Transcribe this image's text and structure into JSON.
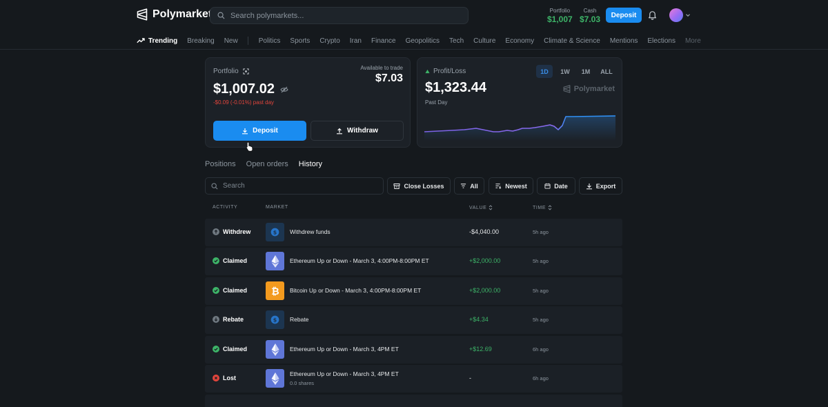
{
  "header": {
    "brand": "Polymarket",
    "search_placeholder": "Search polymarkets...",
    "portfolio_label": "Portfolio",
    "portfolio_value": "$1,007",
    "cash_label": "Cash",
    "cash_value": "$7.03",
    "deposit_label": "Deposit"
  },
  "nav": {
    "trending": "Trending",
    "items": [
      "Breaking",
      "New"
    ],
    "categories": [
      "Politics",
      "Sports",
      "Crypto",
      "Iran",
      "Finance",
      "Geopolitics",
      "Tech",
      "Culture",
      "Economy",
      "Climate & Science",
      "Mentions",
      "Elections"
    ],
    "more": "More"
  },
  "portfolio_card": {
    "label": "Portfolio",
    "value": "$1,007.02",
    "change": "-$0.09 (-0.01%) past day",
    "available_label": "Available to trade",
    "available_value": "$7.03",
    "deposit_label": "Deposit",
    "withdraw_label": "Withdraw"
  },
  "pnl_card": {
    "label": "Profit/Loss",
    "value": "$1,323.44",
    "period": "Past Day",
    "ranges": [
      "1D",
      "1W",
      "1M",
      "ALL"
    ],
    "active_range": "1D",
    "watermark": "Polymarket",
    "line_color": "#7b62e6",
    "line_color_end": "#2f8ff2"
  },
  "tabs": [
    "Positions",
    "Open orders",
    "History"
  ],
  "active_tab": "History",
  "toolbar": {
    "search_placeholder": "Search",
    "close_losses": "Close Losses",
    "filter": "All",
    "sort": "Newest",
    "date": "Date",
    "export": "Export"
  },
  "table": {
    "headers": [
      "ACTIVITY",
      "MARKET",
      "VALUE",
      "TIME"
    ],
    "rows": [
      {
        "activity": "Withdrew",
        "market": "Withdrew funds",
        "shares": "",
        "value": "-$4,040.00",
        "time": "5h ago",
        "icon": "usdc-icon"
      },
      {
        "activity": "Claimed",
        "market": "Ethereum Up or Down - March 3, 4:00PM-8:00PM ET",
        "shares": "",
        "value": "+$2,000.00",
        "time": "5h ago",
        "icon": "ethereum-icon"
      },
      {
        "activity": "Claimed",
        "market": "Bitcoin Up or Down - March 3, 4:00PM-8:00PM ET",
        "shares": "",
        "value": "+$2,000.00",
        "time": "5h ago",
        "icon": "bitcoin-icon"
      },
      {
        "activity": "Rebate",
        "market": "Rebate",
        "shares": "",
        "value": "+$4.34",
        "time": "5h ago",
        "icon": "usdc-icon"
      },
      {
        "activity": "Claimed",
        "market": "Ethereum Up or Down - March 3, 4PM ET",
        "shares": "",
        "value": "+$12.69",
        "time": "6h ago",
        "icon": "ethereum-icon"
      },
      {
        "activity": "Lost",
        "market": "Ethereum Up or Down - March 3, 4PM ET",
        "shares": "0.0 shares",
        "value": "-",
        "time": "6h ago",
        "icon": "ethereum-icon"
      }
    ]
  },
  "colors": {
    "accent": "#1a8cf0",
    "positive": "#3db468",
    "negative": "#e2453c"
  }
}
